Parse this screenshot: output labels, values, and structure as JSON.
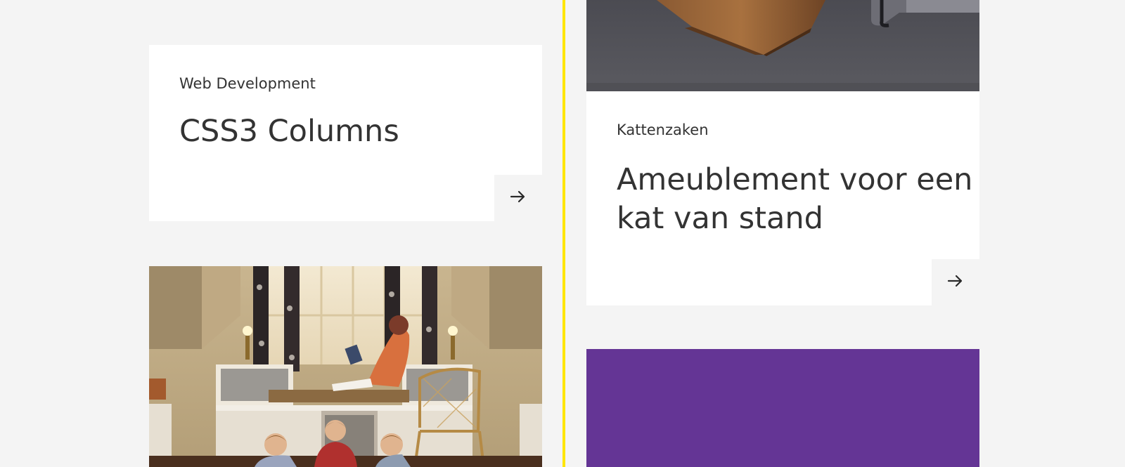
{
  "theme": {
    "background": "#f4f4f4",
    "card_background": "#ffffff",
    "divider_color": "#ffe600",
    "text_color": "#333333",
    "purple_block": "#643595"
  },
  "cards": {
    "css3": {
      "category": "Web Development",
      "title": "CSS3 Columns",
      "arrow_icon": "arrow-right-icon"
    },
    "kat": {
      "category": "Kattenzaken",
      "title_line1": "Ameublement voor een",
      "title_line2": "kat van stand",
      "arrow_icon": "arrow-right-icon"
    }
  },
  "images": {
    "furniture": "photo-wooden-cat-furniture",
    "living_room": "photo-children-in-living-room"
  }
}
